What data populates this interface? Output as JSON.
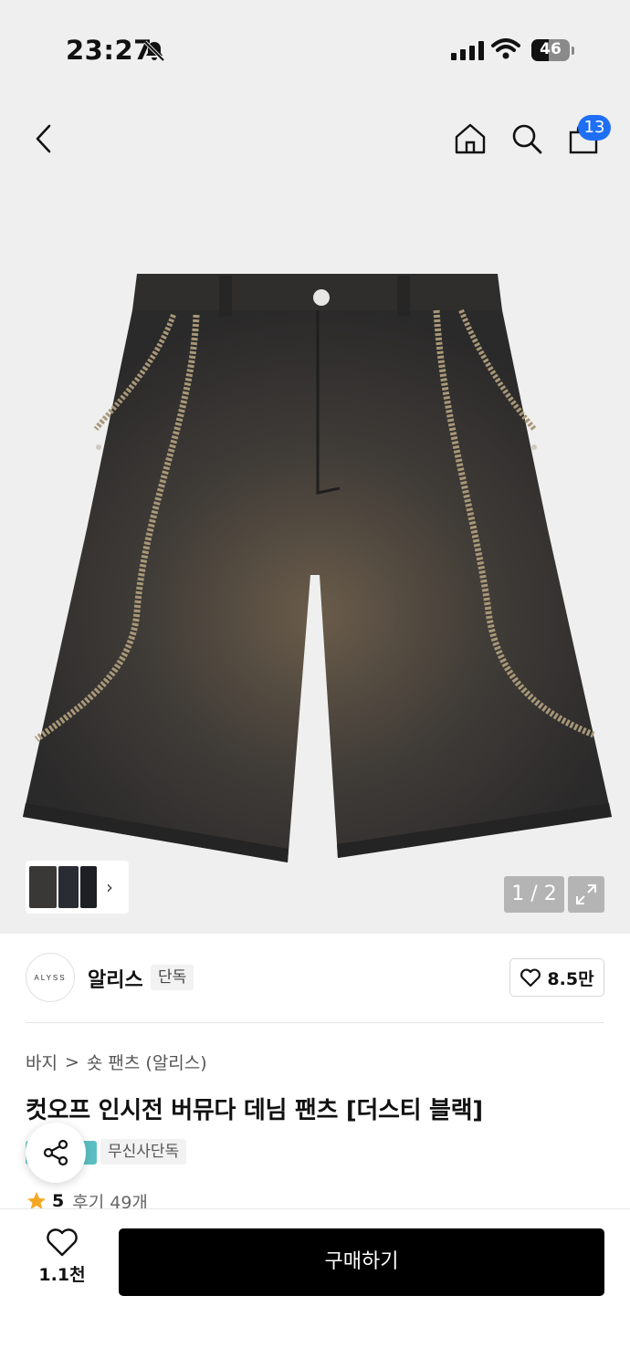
{
  "status_bar": {
    "time": "23:27",
    "battery": "46",
    "battery_level": 0.46
  },
  "header": {
    "cart_count": "13"
  },
  "gallery": {
    "counter": "1 / 2"
  },
  "brand": {
    "logo_text": "ALYSS",
    "name": "알리스",
    "tag": "단독",
    "likes": "8.5만"
  },
  "breadcrumb": {
    "category": "바지",
    "separator": ">",
    "subcategory": "숏 팬츠 (알리스)"
  },
  "product": {
    "title": "컷오프 인시전 버뮤다 데님 팬츠 [더스티 블랙]",
    "badge": "무신사단독"
  },
  "rating": {
    "score": "5",
    "reviews": "후기 49개"
  },
  "bottom_bar": {
    "wish_count": "1.1천",
    "buy_label": "구매하기"
  },
  "colors": {
    "badge_blue": "#1e6ff5",
    "teal_chip": "#5bc0c4",
    "star": "#f5a623",
    "buy_button": "#000000"
  }
}
